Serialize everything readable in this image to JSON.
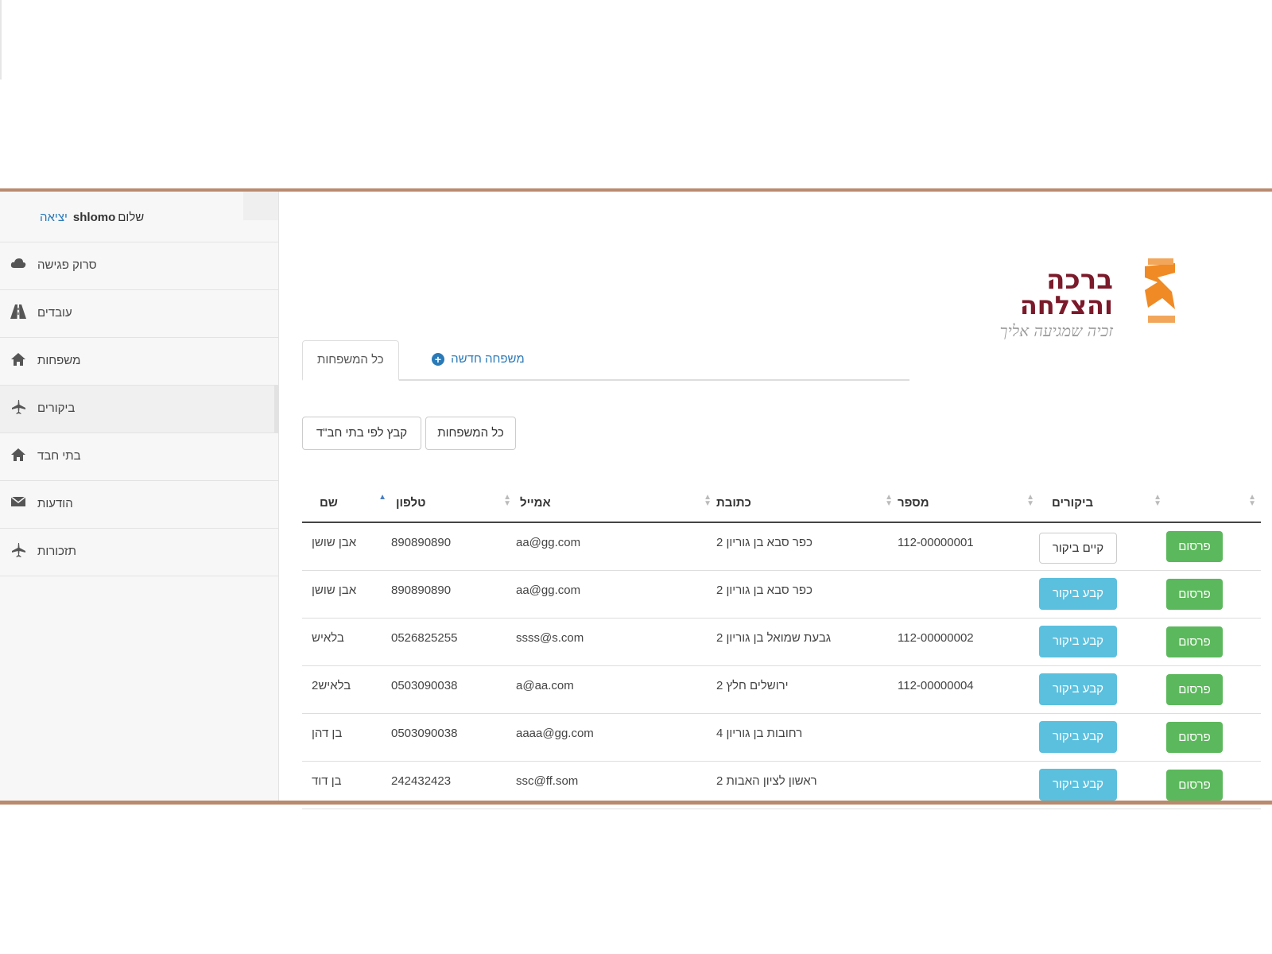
{
  "sidebar": {
    "greeting": "שלום",
    "username": "shlomo",
    "logout": "יציאה",
    "items": [
      {
        "label": "סרוק פגישה",
        "icon": "cloud-icon"
      },
      {
        "label": "עובדים",
        "icon": "road-icon"
      },
      {
        "label": "משפחות",
        "icon": "home-icon"
      },
      {
        "label": "ביקורים",
        "icon": "plane-icon"
      },
      {
        "label": "בתי חבד",
        "icon": "home-icon"
      },
      {
        "label": "הודעות",
        "icon": "envelope-icon"
      },
      {
        "label": "תזכורות",
        "icon": "plane-icon"
      }
    ]
  },
  "logo": {
    "line1": "ברכה",
    "line2": "והצלחה",
    "tagline": "זכיה שמגיעה אליך"
  },
  "tabs": {
    "all_families": "כל המשפחות",
    "new_family": "משפחה חדשה"
  },
  "filters": {
    "group_by_chabad": "קבץ לפי בתי חב\"ד",
    "all_families": "כל המשפחות"
  },
  "table": {
    "headers": {
      "name": "שם",
      "phone": "טלפון",
      "email": "אמייל",
      "address": "כתובת",
      "number": "מספר",
      "visits": "ביקורים"
    },
    "rows": [
      {
        "name": "אבן שושן",
        "phone": "890890890",
        "email": "aa@gg.com",
        "address": "כפר סבא בן גוריון 2",
        "number": "112-00000001",
        "visit_button": "קיים ביקור",
        "visit_state": "exists",
        "publish": "פרסום"
      },
      {
        "name": "אבן שושן",
        "phone": "890890890",
        "email": "aa@gg.com",
        "address": "כפר סבא בן גוריון 2",
        "number": "",
        "visit_button": "קבע ביקור",
        "visit_state": "set",
        "publish": "פרסום"
      },
      {
        "name": "בלאיש",
        "phone": "0526825255",
        "email": "ssss@s.com",
        "address": "גבעת שמואל בן גוריון 2",
        "number": "112-00000002",
        "visit_button": "קבע ביקור",
        "visit_state": "set",
        "publish": "פרסום"
      },
      {
        "name": "בלאיש2",
        "phone": "0503090038",
        "email": "a@aa.com",
        "address": "ירושלים חלץ 2",
        "number": "112-00000004",
        "visit_button": "קבע ביקור",
        "visit_state": "set",
        "publish": "פרסום"
      },
      {
        "name": "בן דהן",
        "phone": "0503090038",
        "email": "aaaa@gg.com",
        "address": "רחובות בן גוריון 4",
        "number": "",
        "visit_button": "קבע ביקור",
        "visit_state": "set",
        "publish": "פרסום"
      },
      {
        "name": "בן דוד",
        "phone": "242432423",
        "email": "ssc@ff.som",
        "address": "ראשון לציון האבות 2",
        "number": "",
        "visit_button": "קבע ביקור",
        "visit_state": "set",
        "publish": "פרסום"
      }
    ]
  },
  "colors": {
    "frame": "#b98a6e",
    "link": "#2a7ab8",
    "info_button": "#5bc0de",
    "success_button": "#5cb85c",
    "logo_red": "#7a1a2a",
    "logo_orange": "#f08a24"
  }
}
